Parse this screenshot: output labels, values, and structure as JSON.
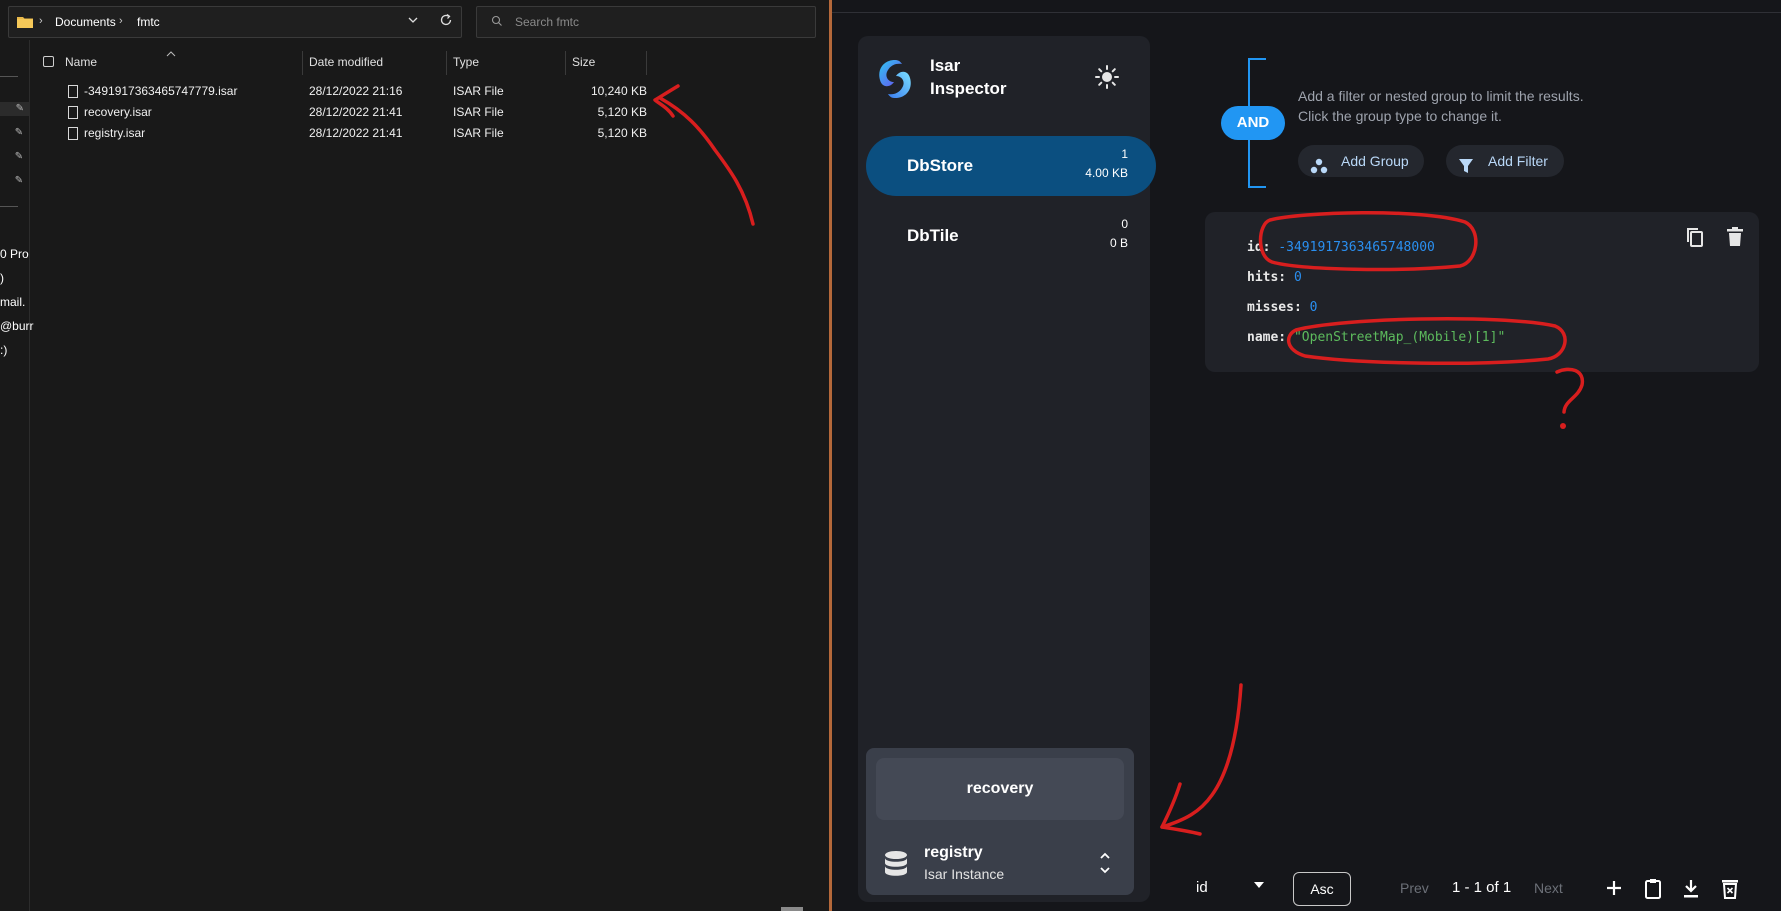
{
  "explorer": {
    "breadcrumb": [
      "Documents",
      "fmtc"
    ],
    "search_placeholder": "Search fmtc",
    "nav_truncated": [
      "0 Pro",
      ")",
      "mail.",
      "@burr",
      ":)"
    ],
    "columns": {
      "name": "Name",
      "date": "Date modified",
      "type": "Type",
      "size": "Size"
    },
    "files": [
      {
        "name": "-3491917363465747779.isar",
        "date": "28/12/2022 21:16",
        "type": "ISAR File",
        "size": "10,240 KB"
      },
      {
        "name": "recovery.isar",
        "date": "28/12/2022 21:41",
        "type": "ISAR File",
        "size": "5,120 KB"
      },
      {
        "name": "registry.isar",
        "date": "28/12/2022 21:41",
        "type": "ISAR File",
        "size": "5,120 KB"
      }
    ]
  },
  "inspector": {
    "brand_line1": "Isar",
    "brand_line2": "Inspector",
    "collections": [
      {
        "name": "DbStore",
        "count": "1",
        "size": "4.00 KB",
        "active": true
      },
      {
        "name": "DbTile",
        "count": "0",
        "size": "0 B",
        "active": false
      }
    ],
    "instances": {
      "other": "recovery",
      "current": "registry",
      "current_sub": "Isar Instance"
    },
    "filter": {
      "group_type": "AND",
      "hint_line1": "Add a filter or nested group to limit the results.",
      "hint_line2": "Click the group type to change it.",
      "add_group": "Add Group",
      "add_filter": "Add Filter"
    },
    "object": {
      "id_key": "id:",
      "id_val": "-3491917363465748000",
      "hits_key": "hits:",
      "hits_val": "0",
      "misses_key": "misses:",
      "misses_val": "0",
      "name_key": "name:",
      "name_val": "\"OpenStreetMap_(Mobile)[1]\""
    },
    "bottom": {
      "sort_field": "id",
      "sort_order": "Asc",
      "prev": "Prev",
      "page_info": "1 - 1 of 1",
      "next": "Next"
    }
  },
  "annotation": {
    "question_mark": "?"
  },
  "colors": {
    "accent": "#2196f3",
    "active_collection": "#0b4f80",
    "ink": "#d81e1e",
    "divider": "#b4683a"
  }
}
